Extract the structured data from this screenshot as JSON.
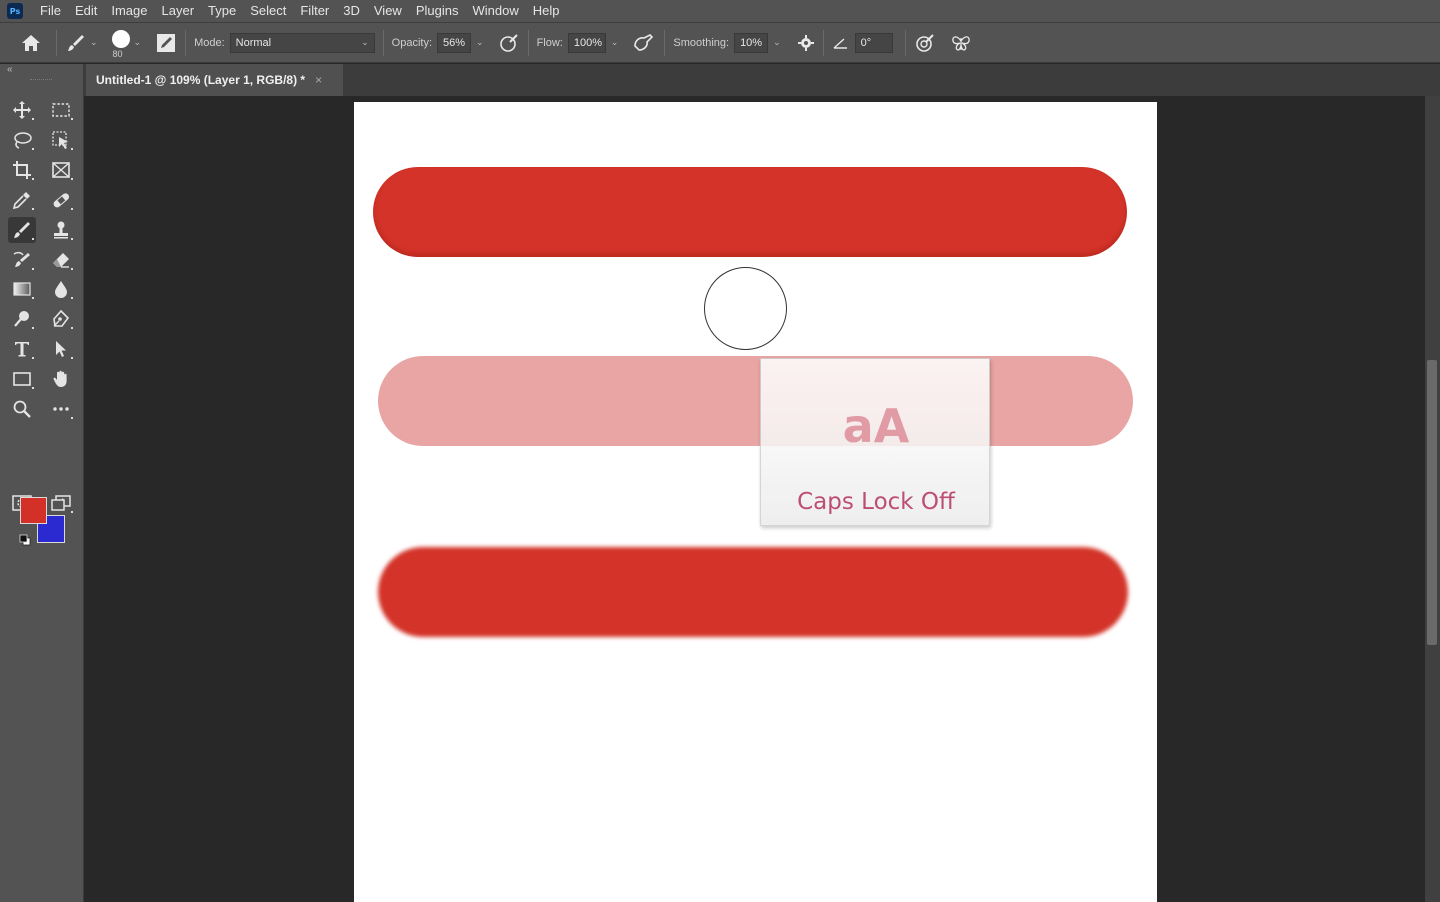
{
  "app": {
    "logo_text": "Ps"
  },
  "menu": [
    "File",
    "Edit",
    "Image",
    "Layer",
    "Type",
    "Select",
    "Filter",
    "3D",
    "View",
    "Plugins",
    "Window",
    "Help"
  ],
  "options": {
    "brush_size": "80",
    "mode_label": "Mode:",
    "mode_value": "Normal",
    "opacity_label": "Opacity:",
    "opacity_value": "56%",
    "flow_label": "Flow:",
    "flow_value": "100%",
    "smoothing_label": "Smoothing:",
    "smoothing_value": "10%",
    "angle_value": "0°"
  },
  "tabs": [
    {
      "label": "Untitled-1 @ 109% (Layer 1, RGB/8) *",
      "close": "×"
    }
  ],
  "toolbar": {
    "collapse": "«",
    "foreground_color": "#d33127",
    "background_color": "#2a2ad0",
    "active_tool": "brush-tool"
  },
  "canvas": {
    "stroke_color": "#d33328",
    "stroke_color_light": "#e8a5a3"
  },
  "popup": {
    "icon_text": "aA",
    "message": "Caps Lock Off"
  }
}
